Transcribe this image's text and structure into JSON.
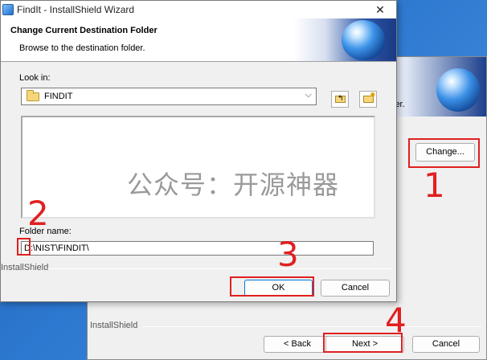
{
  "bg_window": {
    "banner_text": "ler.",
    "change_label": "Change...",
    "installshield_label": "InstallShield",
    "back_label": "< Back",
    "next_label": "Next >",
    "cancel_label": "Cancel"
  },
  "dialog": {
    "title": "FindIt - InstallShield Wizard",
    "close_glyph": "✕",
    "header_title": "Change Current Destination Folder",
    "header_subtitle": "Browse to the destination folder.",
    "lookin_label": "Look in:",
    "lookin_value": "FINDIT",
    "foldername_label": "Folder name:",
    "foldername_value": "D:\\NIST\\FINDIT\\",
    "installshield_label": "InstallShield",
    "ok_label": "OK",
    "cancel_label": "Cancel"
  },
  "watermark_text": "公众号：开源神器",
  "annotations": {
    "n1": "1",
    "n2": "2",
    "n3": "3",
    "n4": "4"
  },
  "colors": {
    "annotation": "#e02020",
    "desktop": "#2d78d0"
  },
  "icons": {
    "app": "app-icon",
    "close": "close-icon",
    "folder": "folder-icon",
    "up_folder": "up-folder-icon",
    "new_folder": "new-folder-icon",
    "dropdown": "chevron-down-icon",
    "globe": "globe-icon"
  }
}
